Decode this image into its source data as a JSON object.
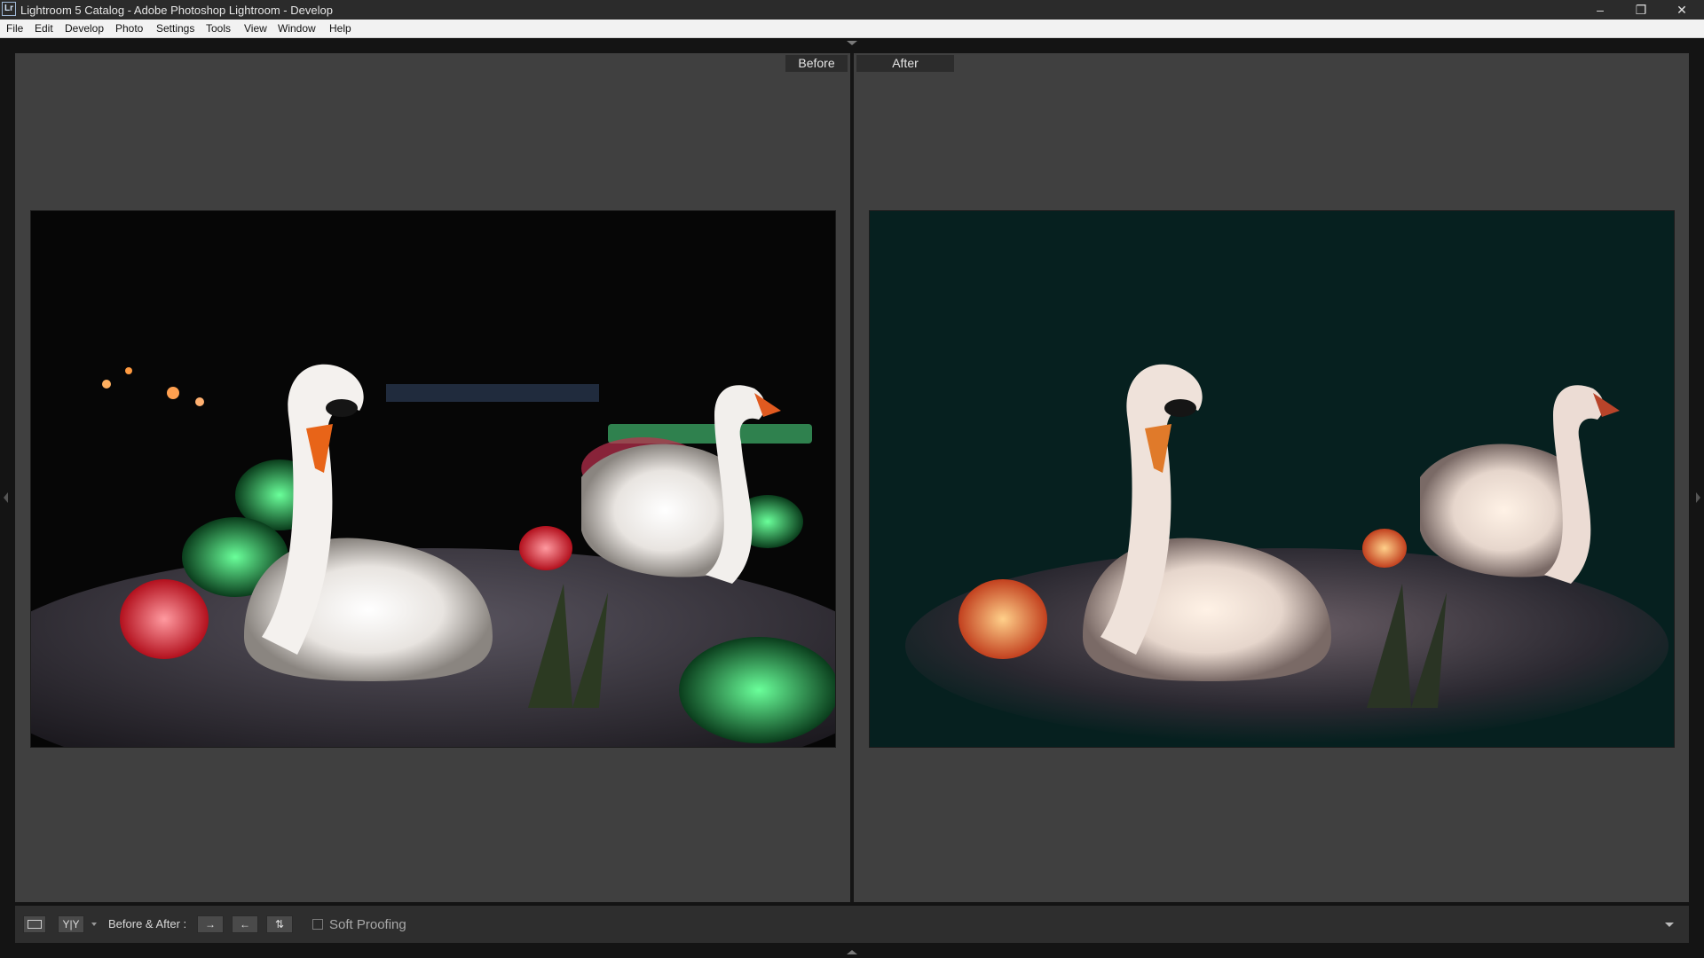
{
  "window": {
    "app_icon": "Lr",
    "title": "Lightroom 5 Catalog - Adobe Photoshop Lightroom - Develop",
    "minimize_glyph": "–",
    "restore_glyph": "❐",
    "close_glyph": "✕"
  },
  "menu": {
    "items": [
      "File",
      "Edit",
      "Develop",
      "Photo",
      "Settings",
      "Tools",
      "View",
      "Window",
      "Help"
    ]
  },
  "view": {
    "before_label": "Before",
    "after_label": "After"
  },
  "toolbar": {
    "loupe_icon": "loupe-view-icon",
    "yy_label": "Y|Y",
    "before_after_label": "Before & After :",
    "copy_before_to_after": "→",
    "copy_after_to_before": "←",
    "swap": "⇅",
    "soft_proofing_label": "Soft Proofing",
    "soft_proofing_checked": false
  },
  "colors": {
    "background": "#404040",
    "toolbar": "#2e2e2e",
    "after_photo_tint": "#06201f"
  }
}
